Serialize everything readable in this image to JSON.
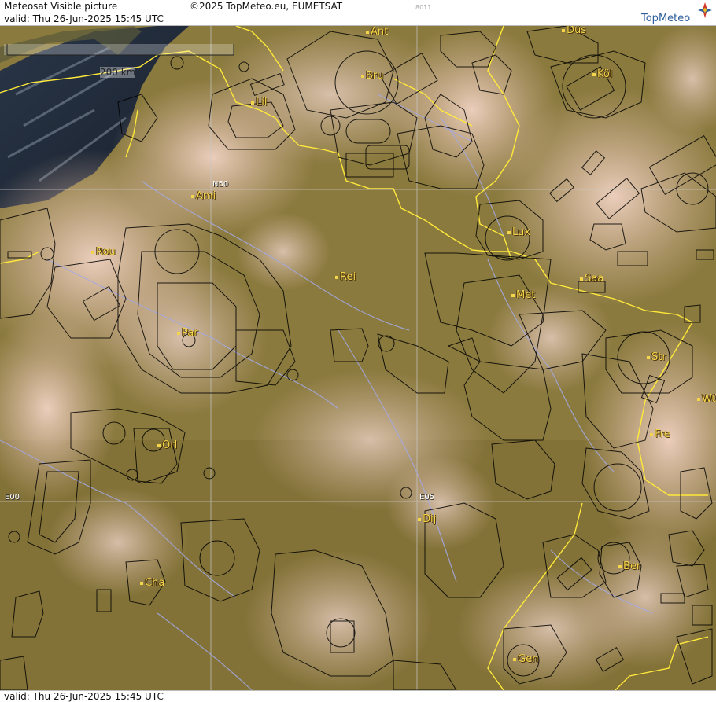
{
  "header": {
    "title": "Meteosat Visible picture",
    "valid": "valid:  Thu  26-Jun-2025  15:45 UTC",
    "copyright": "©2025 TopMeteo.eu, EUMETSAT",
    "code": "8011",
    "logo": "TopMeteo"
  },
  "footer": {
    "valid": "valid:  Thu  26-Jun-2025  15:45 UTC"
  },
  "scale": {
    "label": "200 km"
  },
  "grid": {
    "lat_label": "N50",
    "lon_labels": [
      "E00",
      "E05"
    ]
  },
  "cities": [
    {
      "name": "Ant"
    },
    {
      "name": "Düs"
    },
    {
      "name": "Bru"
    },
    {
      "name": "Köl"
    },
    {
      "name": "Lil"
    },
    {
      "name": "Ami"
    },
    {
      "name": "Rou"
    },
    {
      "name": "Lux"
    },
    {
      "name": "Rei"
    },
    {
      "name": "Saa"
    },
    {
      "name": "Met"
    },
    {
      "name": "Par"
    },
    {
      "name": "Str"
    },
    {
      "name": "Wü"
    },
    {
      "name": "Fre"
    },
    {
      "name": "Orl"
    },
    {
      "name": "Dij"
    },
    {
      "name": "Ber"
    },
    {
      "name": "Cha"
    },
    {
      "name": "Gen"
    }
  ],
  "colors": {
    "land": "#8c7a3e",
    "cloud": "#e8c7b4",
    "dark_cloud": "#1e2a3c",
    "border": "#ffea3a",
    "river": "#9ea6e0",
    "airspace": "#000000"
  }
}
